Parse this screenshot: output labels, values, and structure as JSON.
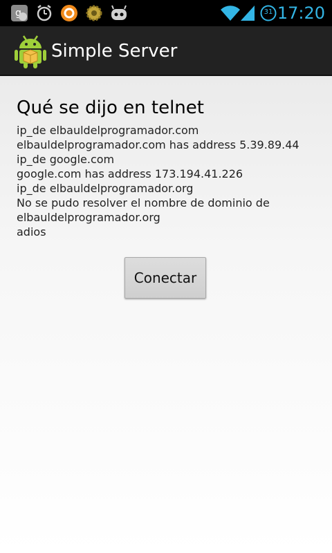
{
  "status_bar": {
    "clock": "17:20",
    "calendar_day": "31",
    "accent_color": "#33b5e5",
    "notification_icons": [
      "google-talk-icon",
      "alarm-clock-icon",
      "orange-circle-app-icon",
      "gear-icon",
      "cyanogenmod-icon"
    ],
    "system_icons": [
      "wifi-icon",
      "signal-strength-icon",
      "calendar-icon"
    ]
  },
  "action_bar": {
    "title": "Simple Server",
    "icon": "android-app-icon",
    "background": "#222222"
  },
  "main": {
    "heading": "Qué se dijo en telnet",
    "log_lines": [
      "ip_de elbauldelprogramador.com",
      "elbauldelprogramador.com has address 5.39.89.44",
      "ip_de google.com",
      "google.com has address 173.194.41.226",
      "ip_de elbauldelprogramador.org",
      "No se pudo resolver el nombre de dominio de elbauldelprogramador.org",
      "adios"
    ],
    "connect_button_label": "Conectar"
  }
}
